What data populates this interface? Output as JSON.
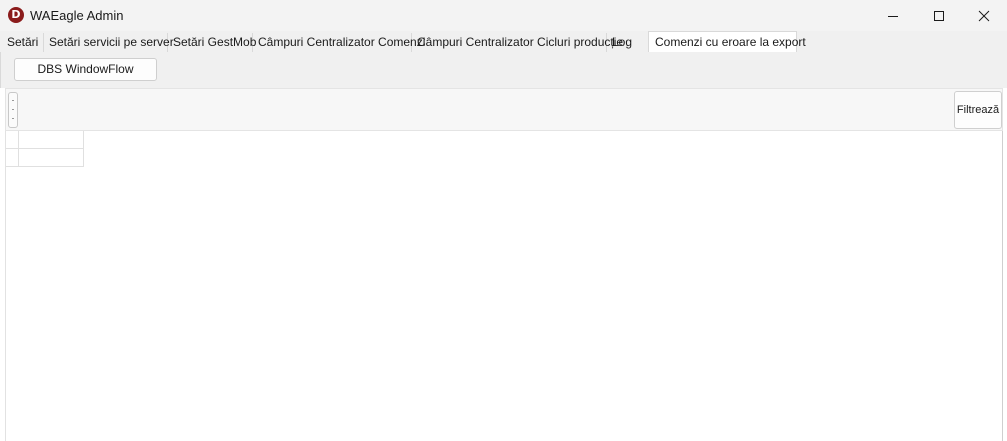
{
  "window": {
    "icon_letter": "D",
    "title": "WAEagle Admin",
    "controls": [
      "minimize",
      "maximize",
      "close"
    ]
  },
  "tabs": [
    {
      "label": "Setări",
      "active": false
    },
    {
      "label": "Setări servicii pe server",
      "active": false
    },
    {
      "label": "Setări GestMob",
      "active": false
    },
    {
      "label": "Câmpuri Centralizator Comenzi",
      "active": false
    },
    {
      "label": "Câmpuri Centralizator Cicluri producție",
      "active": false
    },
    {
      "label": "Log",
      "active": false
    },
    {
      "label": "Comenzi cu eroare la export",
      "active": true
    }
  ],
  "toolbar": {
    "dbs_button_label": "DBS WindowFlow"
  },
  "filter": {
    "filter_button_label": "Filtrează"
  },
  "grid": {
    "rows": [
      {
        "cells": [
          ""
        ]
      },
      {
        "cells": [
          ""
        ]
      }
    ]
  }
}
